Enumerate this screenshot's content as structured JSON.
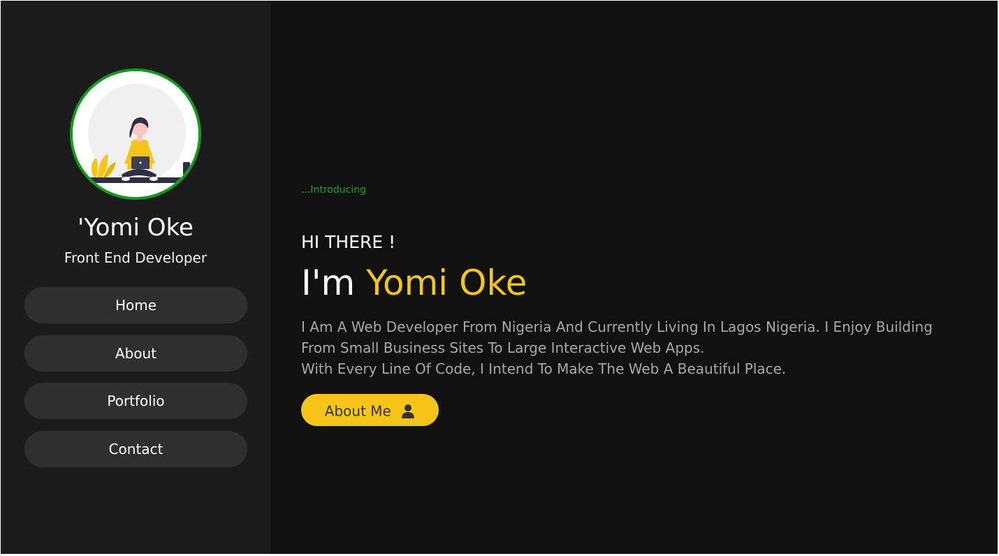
{
  "sidebar": {
    "name": "'Yomi Oke",
    "role": "Front End Developer",
    "nav": [
      {
        "label": "Home"
      },
      {
        "label": "About"
      },
      {
        "label": "Portfolio"
      },
      {
        "label": "Contact"
      }
    ]
  },
  "main": {
    "intro": "...Introducing",
    "greeting": "HI THERE !",
    "name_prefix": "I'm",
    "name_highlight": "Yomi Oke",
    "description_line1": "I Am A Web Developer From Nigeria And Currently Living In Lagos Nigeria. I Enjoy Building From Small Business Sites To Large Interactive Web Apps.",
    "description_line2": "With Every Line Of Code, I Intend To Make The Web A Beautiful Place.",
    "about_button": "About Me",
    "about_button_icon": "user-icon"
  },
  "colors": {
    "accent_yellow": "#f5c518",
    "accent_green": "#129c1e",
    "sidebar_bg": "#1c1c1c",
    "main_bg": "#111111",
    "nav_bg": "#2f2f2f"
  }
}
